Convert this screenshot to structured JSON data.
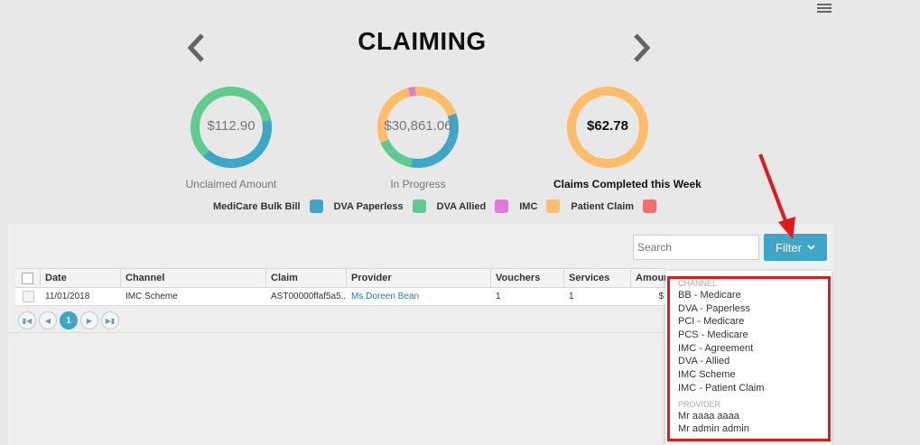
{
  "header": {
    "title": "CLAIMING"
  },
  "stats": [
    {
      "value": "$112.90",
      "label": "Unclaimed Amount"
    },
    {
      "value": "$30,861.06",
      "label": "In Progress"
    },
    {
      "value": "$62.78",
      "label": "Claims Completed this Week"
    }
  ],
  "legend": [
    {
      "label": "MediCare Bulk Bill",
      "color": "#3ea6c6"
    },
    {
      "label": "DVA Paperless",
      "color": "#5fcb8f"
    },
    {
      "label": "DVA Allied",
      "color": "#e07ad8"
    },
    {
      "label": "IMC",
      "color": "#fdbd6a"
    },
    {
      "label": "Patient Claim",
      "color": "#f07070"
    }
  ],
  "toolbar": {
    "search_placeholder": "Search",
    "filter_label": "Filter"
  },
  "table": {
    "columns": [
      "Date",
      "Channel",
      "Claim",
      "Provider",
      "Vouchers",
      "Services",
      "Amount"
    ],
    "rows": [
      {
        "date": "11/01/2018",
        "channel": "IMC Scheme",
        "claim": "AST00000ffaf5a5...",
        "provider": "Ms Doreen Bean",
        "vouchers": "1",
        "services": "1",
        "amount": "$"
      }
    ]
  },
  "pager": {
    "current_page": "1",
    "first_icon": "first-page-icon",
    "prev_icon": "prev-page-icon",
    "next_icon": "next-page-icon",
    "last_icon": "last-page-icon"
  },
  "filter_menu": {
    "channel_heading": "CHANNEL",
    "channels": [
      "BB - Medicare",
      "DVA - Paperless",
      "PCI - Medicare",
      "PCS - Medicare",
      "IMC - Agreement",
      "DVA - Allied",
      "IMC Scheme",
      "IMC - Patient Claim"
    ],
    "provider_heading": "PROVIDER",
    "providers": [
      "Mr aaaa aaaa",
      "Mr admin admin"
    ]
  },
  "colors": {
    "accent": "#3ea6c6",
    "annotation": "#e01a1a"
  }
}
